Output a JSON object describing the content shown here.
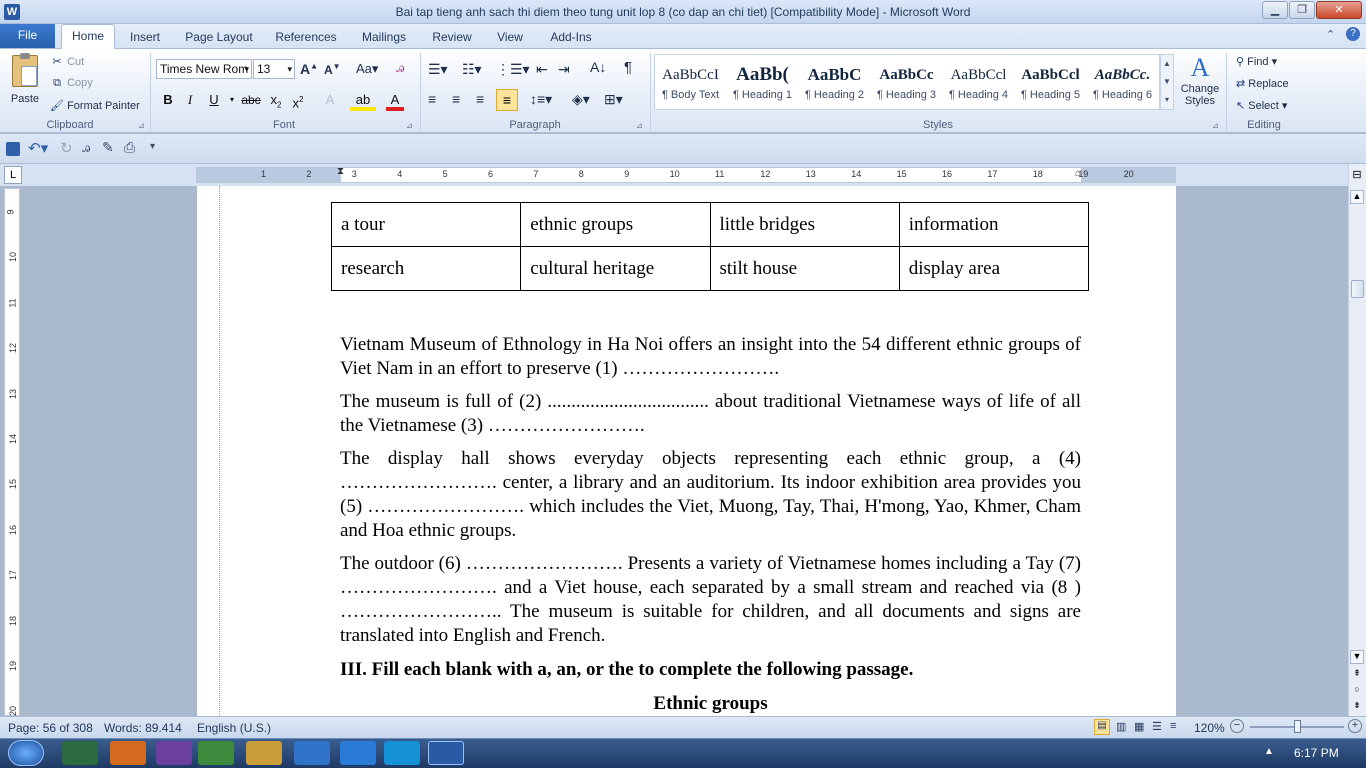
{
  "window": {
    "title": "Bai tap tieng anh sach thi diem theo tung unit lop 8 (co dap an chi tiet) [Compatibility Mode]  -  Microsoft Word"
  },
  "tabs": [
    "File",
    "Home",
    "Insert",
    "Page Layout",
    "References",
    "Mailings",
    "Review",
    "View",
    "Add-Ins"
  ],
  "clipboard": {
    "paste": "Paste",
    "cut": "Cut",
    "copy": "Copy",
    "format_painter": "Format Painter",
    "label": "Clipboard"
  },
  "font": {
    "name": "Times New Rom",
    "size": "13",
    "label": "Font"
  },
  "paragraph": {
    "label": "Paragraph"
  },
  "styles": {
    "label": "Styles",
    "items": [
      {
        "preview": "AaBbCcI",
        "name": "¶ Body Text"
      },
      {
        "preview": "AaBb(",
        "name": "¶ Heading 1"
      },
      {
        "preview": "AaBbC",
        "name": "¶ Heading 2"
      },
      {
        "preview": "AaBbCc",
        "name": "¶ Heading 3"
      },
      {
        "preview": "AaBbCcl",
        "name": "¶ Heading 4"
      },
      {
        "preview": "AaBbCcl",
        "name": "¶ Heading 5"
      },
      {
        "preview": "AaBbCc.",
        "name": "¶ Heading 6"
      }
    ],
    "change": "Change Styles"
  },
  "editing": {
    "find": "Find",
    "replace": "Replace",
    "select": "Select",
    "label": "Editing"
  },
  "ruler": {
    "h_ticks": [
      "1",
      "2",
      "3",
      "4",
      "5",
      "6",
      "7",
      "8",
      "9",
      "10",
      "11",
      "12",
      "13",
      "14",
      "15",
      "16",
      "17",
      "18",
      "19",
      "20"
    ],
    "v_ticks": [
      "9",
      "10",
      "11",
      "12",
      "13",
      "14",
      "15",
      "16",
      "17",
      "18",
      "19",
      "20"
    ]
  },
  "document": {
    "table": [
      [
        "a tour",
        "ethnic groups",
        "little bridges",
        "information"
      ],
      [
        "research",
        "cultural heritage",
        "stilt house",
        "display area"
      ]
    ],
    "p1": "Vietnam Museum of Ethnology in Ha Noi offers an insight into the 54 different ethnic groups of Viet Nam in an effort to preserve (1) …………………….",
    "p2": "The museum is full of (2) .................................. about traditional Vietnamese ways of life of all the Vietnamese (3) …………………….",
    "p3": "The display hall shows everyday objects representing each ethnic group, a (4) ……………………. center, a library and an auditorium. Its indoor exhibition area provides you (5) ……………………. which includes the Viet, Muong, Tay, Thai, H'mong, Yao, Khmer, Cham and Hoa ethnic groups.",
    "p4": "The outdoor (6) ……………………. Presents a variety of Vietnamese homes including a Tay (7) ……………………. and a Viet house, each separated by a small stream and reached via (8 ) …………………….. The museum is suitable for children, and all documents and signs are translated into English and French.",
    "heading_III": "III. Fill each blank with a, an, or the to complete the following passage.",
    "subtitle": "Ethnic groups"
  },
  "status": {
    "page": "Page: 56 of 308",
    "words": "Words: 89.414",
    "language": "English (U.S.)",
    "zoom": "120%"
  },
  "taskbar": {
    "time": "6:17 PM"
  }
}
